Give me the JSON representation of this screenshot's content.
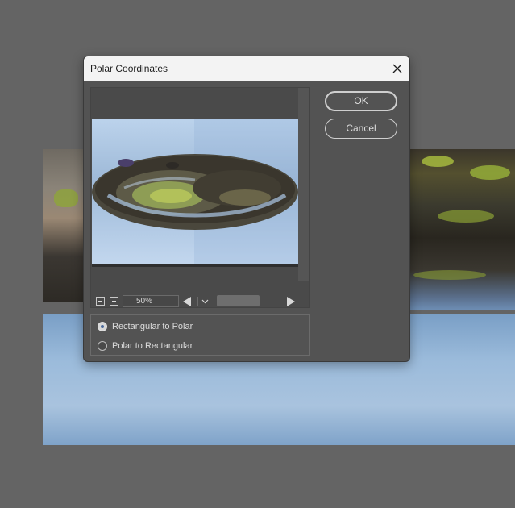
{
  "dialog": {
    "title": "Polar Coordinates",
    "ok_label": "OK",
    "cancel_label": "Cancel"
  },
  "zoom": {
    "value": "50%"
  },
  "options": [
    {
      "label": "Rectangular to Polar",
      "selected": true
    },
    {
      "label": "Polar to Rectangular",
      "selected": false
    }
  ],
  "icons": {
    "close": "close-icon",
    "zoom_out": "zoom-out-icon",
    "zoom_in": "zoom-in-icon",
    "dropdown": "chevron-down-icon",
    "scroll_left": "triangle-left-icon",
    "scroll_right": "triangle-right-icon"
  },
  "colors": {
    "workspace_bg": "#646464",
    "dialog_bg": "#535353",
    "titlebar_bg": "#f3f3f3"
  }
}
